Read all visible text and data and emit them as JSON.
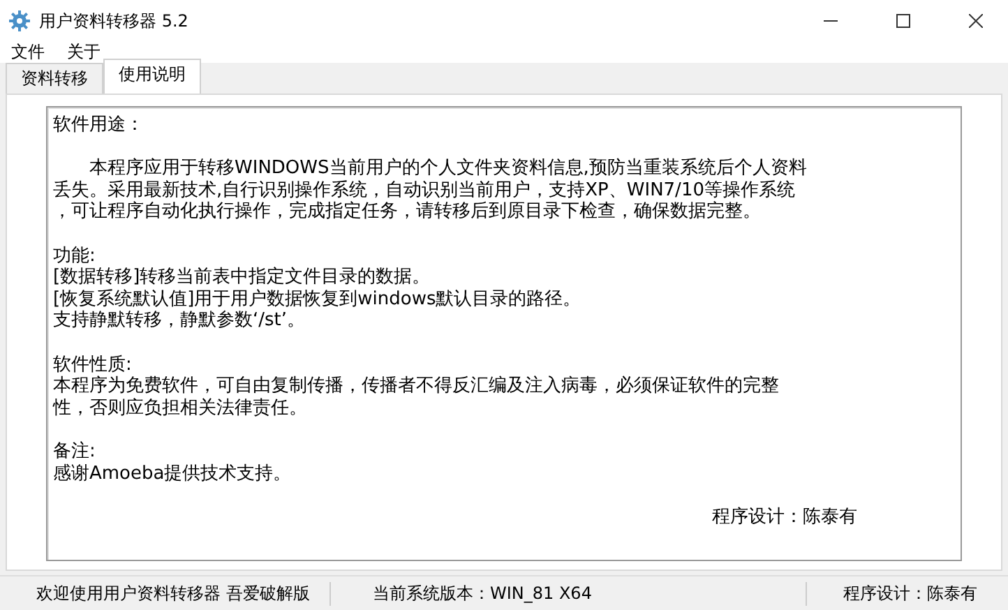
{
  "window": {
    "title": "用户资料转移器 5.2"
  },
  "menu": [
    "文件",
    "关于"
  ],
  "tabs": [
    {
      "label": "资料转移",
      "selected": false
    },
    {
      "label": "使用说明",
      "selected": true
    }
  ],
  "content": {
    "paragraphs": [
      {
        "lines": [
          "软件用途："
        ]
      },
      {
        "lines": [
          "　　本程序应用于转移WINDOWS当前用户的个人文件夹资料信息,预防当重装系统后个人资料",
          "丢失。采用最新技术,自行识别操作系统，自动识别当前用户，支持XP、WIN7/10等操作系统",
          "，可让程序自动化执行操作，完成指定任务，请转移后到原目录下检查，确保数据完整。"
        ]
      },
      {
        "lines": [
          "功能:",
          "[数据转移]转移当前表中指定文件目录的数据。",
          "[恢复系统默认值]用于用户数据恢复到windows默认目录的路径。",
          "支持静默转移，静默参数‘/st’。"
        ]
      },
      {
        "lines": [
          "软件性质:",
          "本程序为免费软件，可自由复制传播，传播者不得反汇编及注入病毒，必须保证软件的完整",
          "性，否则应负担相关法律责任。"
        ]
      },
      {
        "lines": [
          "备注:",
          "感谢Amoeba提供技术支持。"
        ]
      }
    ],
    "signature": "程序设计：陈泰有"
  },
  "status_bar": [
    "欢迎使用用户资料转移器 吾爱破解版",
    "当前系统版本：WIN_81 X64",
    "程序设计：陈泰有"
  ]
}
